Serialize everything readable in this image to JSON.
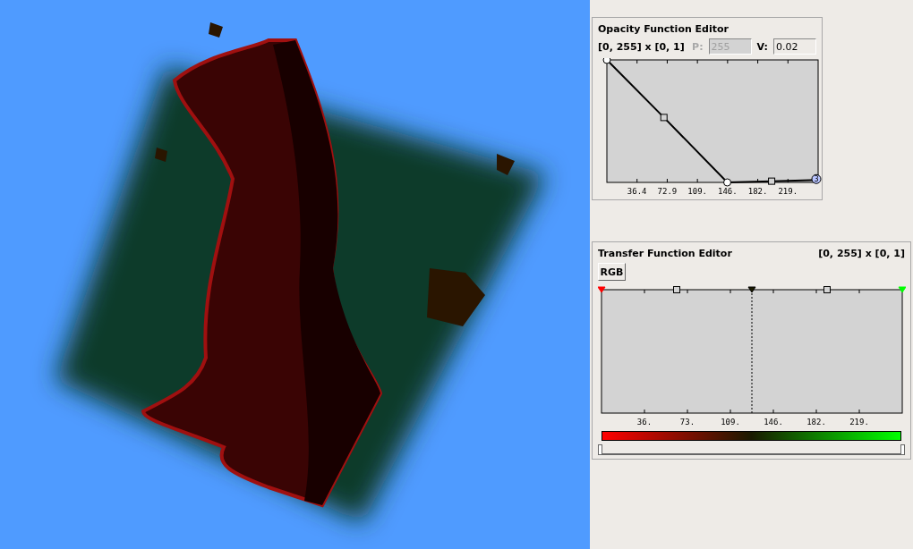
{
  "opacity_editor": {
    "title": "Opacity Function Editor",
    "range": "[0, 255] x [0, 1]",
    "point_field": {
      "label": "P:",
      "value": "255",
      "disabled": true
    },
    "value_field": {
      "label": "V:",
      "value": "0.02"
    },
    "ticks": [
      "36.4",
      "72.9",
      "109.",
      "146.",
      "182.",
      "219."
    ],
    "nodes": [
      {
        "kind": "circle"
      },
      {
        "kind": "square"
      },
      {
        "kind": "circle"
      },
      {
        "kind": "square"
      },
      {
        "kind": "selected",
        "label": "3"
      }
    ]
  },
  "transfer_editor": {
    "title": "Transfer Function Editor",
    "range": "[0, 255] x [0, 1]",
    "mode_button": "RGB",
    "color_nodes": [
      {
        "color": "#ff0000",
        "selected": false
      },
      {
        "color": "#1a1a00",
        "selected": true
      },
      {
        "color": "#00ff00",
        "selected": false
      }
    ],
    "ticks": [
      "36.",
      "73.",
      "109.",
      "146.",
      "182.",
      "219."
    ],
    "range_slider": {
      "handles": [
        {
          "level": 0
        },
        {
          "level": 1
        }
      ]
    }
  }
}
